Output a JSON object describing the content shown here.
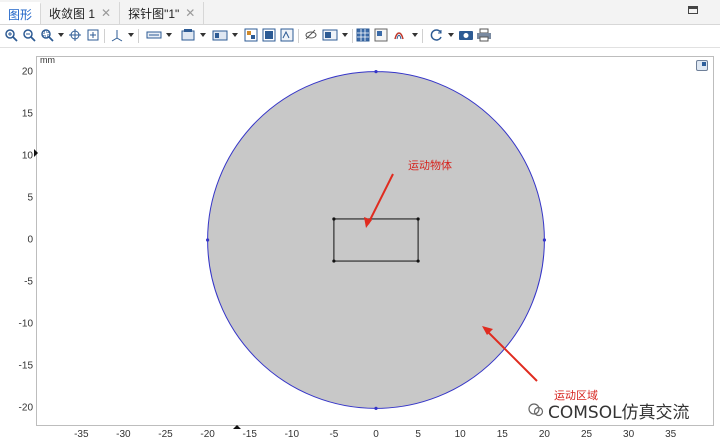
{
  "tabs": [
    {
      "label": "图形",
      "active": true,
      "closable": false
    },
    {
      "label": "收敛图 1",
      "active": false,
      "closable": true
    },
    {
      "label": "探针图\"1\"",
      "active": false,
      "closable": true
    }
  ],
  "toolbar": {
    "icons": [
      "zoom-in-icon",
      "zoom-out-icon",
      "zoom-box-icon",
      "center-icon",
      "zoom-extents-icon",
      "axis-orientation-icon",
      "select-box-icon",
      "select-objects-icon",
      "select-domains-icon",
      "selection-list-icon",
      "clear-selection-icon",
      "show-labels-icon",
      "hide-icon",
      "grid-icon",
      "scene-light-icon",
      "transparency-icon",
      "reset-view-icon",
      "camera-icon",
      "print-icon"
    ]
  },
  "plot": {
    "unit_label": "mm",
    "y_ticks": [
      "20",
      "15",
      "10",
      "5",
      "0",
      "-5",
      "-10",
      "-15",
      "-20"
    ],
    "x_ticks": [
      "-35",
      "-30",
      "-25",
      "-20",
      "-15",
      "-10",
      "-5",
      "0",
      "5",
      "10",
      "15",
      "20",
      "25",
      "30",
      "35"
    ],
    "geometry": {
      "circle": {
        "cx": 0,
        "cy": 0,
        "r": 20,
        "fill": "#c8c8c8",
        "stroke": "#3535c8"
      },
      "rectangle": {
        "x_min": -5,
        "x_max": 5,
        "y_min": -2.5,
        "y_max": 2.5,
        "stroke": "#111111"
      }
    },
    "annotations": [
      {
        "text": "运动物体",
        "color": "#d6231e"
      },
      {
        "text": "运动区域",
        "color": "#d6231e"
      }
    ]
  },
  "watermark": {
    "text": "COMSOL仿真交流"
  }
}
